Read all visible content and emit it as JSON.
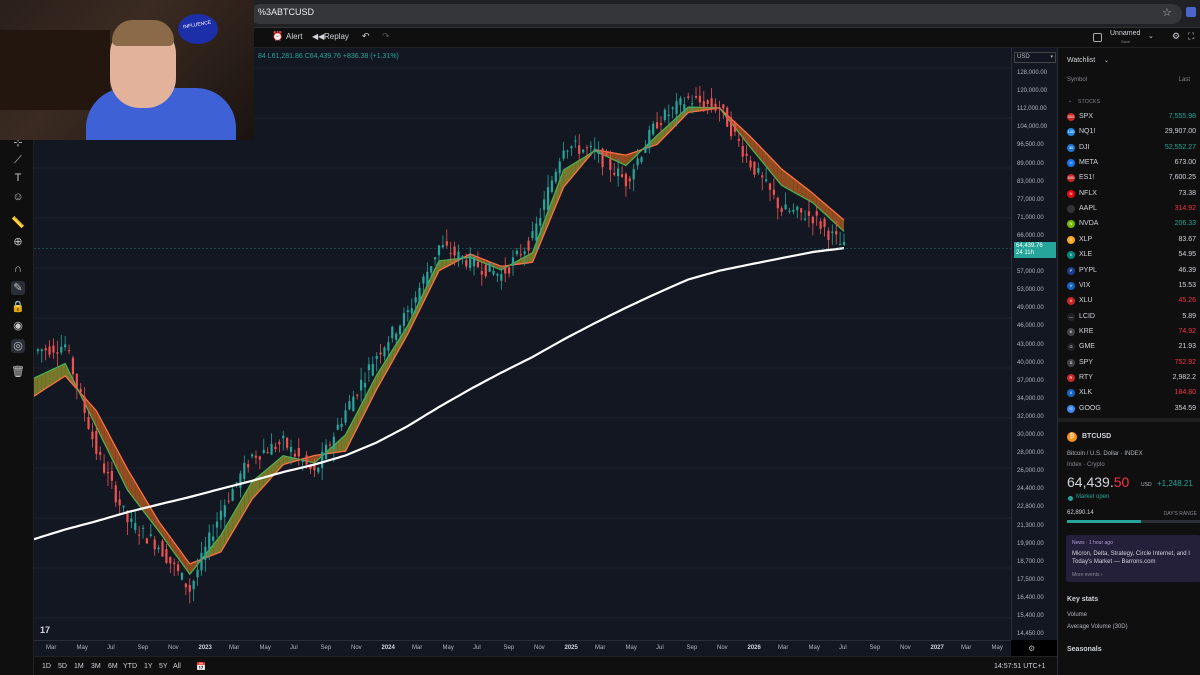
{
  "browser": {
    "url": "%3ABTCUSD"
  },
  "toolbar": {
    "alert_label": "Alert",
    "replay_label": "Replay",
    "layout_name": "Unnamed",
    "layout_sub": "Save"
  },
  "webcam": {
    "logo_text": "INFLUENCE"
  },
  "chart": {
    "ohlc": "84  L61,281.86  C64,439.76  +836.38 (+1.31%)",
    "currency": "USD",
    "last_price": "64,439.76",
    "last_price_sub": "24 11h",
    "price_ticks": [
      "128,000.00",
      "120,000.00",
      "112,000.00",
      "104,000.00",
      "96,500.00",
      "89,000.00",
      "83,000.00",
      "77,000.00",
      "71,000.00",
      "66,000.00",
      "61,000.00",
      "57,000.00",
      "53,000.00",
      "49,000.00",
      "46,000.00",
      "43,000.00",
      "40,000.00",
      "37,000.00",
      "34,000.00",
      "32,000.00",
      "30,000.00",
      "28,000.00",
      "26,000.00",
      "24,400.00",
      "22,800.00",
      "21,300.00",
      "19,900.00",
      "18,700.00",
      "17,500.00",
      "16,400.00",
      "15,400.00",
      "14,450.00"
    ],
    "time_ticks": [
      {
        "label": "Mar",
        "year": false
      },
      {
        "label": "May",
        "year": false
      },
      {
        "label": "Jul",
        "year": false
      },
      {
        "label": "Sep",
        "year": false
      },
      {
        "label": "Nov",
        "year": false
      },
      {
        "label": "2023",
        "year": true
      },
      {
        "label": "Mar",
        "year": false
      },
      {
        "label": "May",
        "year": false
      },
      {
        "label": "Jul",
        "year": false
      },
      {
        "label": "Sep",
        "year": false
      },
      {
        "label": "Nov",
        "year": false
      },
      {
        "label": "2024",
        "year": true
      },
      {
        "label": "Mar",
        "year": false
      },
      {
        "label": "May",
        "year": false
      },
      {
        "label": "Jul",
        "year": false
      },
      {
        "label": "Sep",
        "year": false
      },
      {
        "label": "Nov",
        "year": false
      },
      {
        "label": "2025",
        "year": true
      },
      {
        "label": "Mar",
        "year": false
      },
      {
        "label": "May",
        "year": false
      },
      {
        "label": "Jul",
        "year": false
      },
      {
        "label": "Sep",
        "year": false
      },
      {
        "label": "Nov",
        "year": false
      },
      {
        "label": "2026",
        "year": true
      },
      {
        "label": "Mar",
        "year": false
      },
      {
        "label": "May",
        "year": false
      },
      {
        "label": "Jul",
        "year": false
      },
      {
        "label": "Sep",
        "year": false
      },
      {
        "label": "Nov",
        "year": false
      },
      {
        "label": "2027",
        "year": true
      },
      {
        "label": "Mar",
        "year": false
      },
      {
        "label": "May",
        "year": false
      }
    ],
    "colors": {
      "up": "#26a69a",
      "down": "#ef5350",
      "ribbon_up": "#4caf50",
      "ribbon_down": "#ff7043",
      "ma200": "#ffffff"
    }
  },
  "chart_data": {
    "type": "line",
    "title": "",
    "xlabel": "",
    "ylabel": "",
    "ylog": true,
    "x": [
      "2022-02",
      "2022-04",
      "2022-06",
      "2022-08",
      "2022-10",
      "2022-12",
      "2023-02",
      "2023-04",
      "2023-06",
      "2023-08",
      "2023-10",
      "2023-12",
      "2024-02",
      "2024-04",
      "2024-06",
      "2024-08",
      "2024-10",
      "2024-12",
      "2025-02",
      "2025-04",
      "2025-06",
      "2025-08",
      "2025-10",
      "2025-12",
      "2026-02",
      "2026-04",
      "2026-06"
    ],
    "series": [
      {
        "values": [
          43000,
          44000,
          29000,
          22000,
          20000,
          16800,
          23000,
          28500,
          30000,
          26500,
          34000,
          42500,
          50000,
          65000,
          61000,
          58000,
          67000,
          97000,
          94000,
          84000,
          106000,
          116000,
          112000,
          90000,
          75000,
          73000,
          64440
        ]
      },
      {
        "values": [
          36000,
          39000,
          34000,
          27000,
          22000,
          18600,
          19500,
          24000,
          27500,
          28500,
          29000,
          37000,
          46000,
          59000,
          63000,
          60000,
          61000,
          82000,
          95000,
          93000,
          97000,
          110000,
          112000,
          100000,
          88000,
          80000,
          72000
        ]
      },
      {
        "values": [
          20500,
          21300,
          22000,
          22800,
          23500,
          24200,
          25000,
          25800,
          26700,
          27500,
          28500,
          30000,
          32000,
          34500,
          37000,
          39500,
          42000,
          45000,
          48000,
          51000,
          54000,
          57000,
          59000,
          60500,
          62000,
          63500,
          64500
        ]
      }
    ],
    "last_close": 64439.76
  },
  "watchlist": {
    "title": "Watchlist",
    "col_symbol": "Symbol",
    "col_last": "Last",
    "section": "STOCKS",
    "items": [
      {
        "symbol": "SPX",
        "last": "7,555.98",
        "color": "#26a69a",
        "logo_color": "#c62828",
        "logo": "500"
      },
      {
        "symbol": "NQ1!",
        "last": "29,907.00",
        "color": "#d1d4dc",
        "logo_color": "#1e88e5",
        "logo": "100"
      },
      {
        "symbol": "DJI",
        "last": "52,552.27",
        "color": "#26a69a",
        "logo_color": "#1976d2",
        "logo": "30"
      },
      {
        "symbol": "META",
        "last": "673.00",
        "color": "#d1d4dc",
        "logo_color": "#1877f2",
        "logo": "∞"
      },
      {
        "symbol": "ES1!",
        "last": "7,600.25",
        "color": "#d1d4dc",
        "logo_color": "#c62828",
        "logo": "500"
      },
      {
        "symbol": "NFLX",
        "last": "73.38",
        "color": "#d1d4dc",
        "logo_color": "#e50914",
        "logo": "N"
      },
      {
        "symbol": "AAPL",
        "last": "314.92",
        "color": "#f23645",
        "logo_color": "#333333",
        "logo": ""
      },
      {
        "symbol": "NVDA",
        "last": "206.33",
        "color": "#26a69a",
        "logo_color": "#76b900",
        "logo": "N"
      },
      {
        "symbol": "XLP",
        "last": "83.67",
        "color": "#d1d4dc",
        "logo_color": "#f9a825",
        "logo": "X"
      },
      {
        "symbol": "XLE",
        "last": "54.95",
        "color": "#d1d4dc",
        "logo_color": "#00897b",
        "logo": "X"
      },
      {
        "symbol": "PYPL",
        "last": "46.39",
        "color": "#d1d4dc",
        "logo_color": "#1e3a8a",
        "logo": "P"
      },
      {
        "symbol": "VIX",
        "last": "15.53",
        "color": "#d1d4dc",
        "logo_color": "#1565c0",
        "logo": "V"
      },
      {
        "symbol": "XLU",
        "last": "45.26",
        "color": "#f23645",
        "logo_color": "#c62828",
        "logo": "X"
      },
      {
        "symbol": "LCID",
        "last": "5.89",
        "color": "#d1d4dc",
        "logo_color": "#222222",
        "logo": "—"
      },
      {
        "symbol": "KRE",
        "last": "74.92",
        "color": "#f23645",
        "logo_color": "#444444",
        "logo": "K"
      },
      {
        "symbol": "GME",
        "last": "21.93",
        "color": "#d1d4dc",
        "logo_color": "#222222",
        "logo": "G"
      },
      {
        "symbol": "SPY",
        "last": "752.92",
        "color": "#f23645",
        "logo_color": "#444444",
        "logo": "S"
      },
      {
        "symbol": "RTY",
        "last": "2,982.2",
        "color": "#d1d4dc",
        "logo_color": "#c62828",
        "logo": "R"
      },
      {
        "symbol": "XLK",
        "last": "184.80",
        "color": "#f23645",
        "logo_color": "#1565c0",
        "logo": "X"
      },
      {
        "symbol": "GOOG",
        "last": "354.59",
        "color": "#d1d4dc",
        "logo_color": "#4285f4",
        "logo": "G"
      }
    ]
  },
  "details": {
    "symbol": "BTCUSD",
    "logo": "₿",
    "name": "Bitcoin / U.S. Dollar  ·  INDEX",
    "type": "Index  ·  Crypto",
    "price_int": "64,439.",
    "price_dec": "50",
    "unit": "USD",
    "change": "+1,248.21",
    "status": "Market open",
    "low": "62,890.14",
    "range_label": "DAY'S RANGE",
    "range_fill": 0.55,
    "news_tag": "News  ·  1 hour ago",
    "news_text": "Micron, Delta, Strategy, Circle Internet, and I Today's Market — Barrons.com",
    "news_more": "More events ›",
    "key_stats": "Key stats",
    "volume": "Volume",
    "avg_volume": "Average Volume (30D)",
    "seasonals": "Seasonals"
  },
  "bottom": {
    "ranges": [
      "1D",
      "5D",
      "1M",
      "3M",
      "6M",
      "YTD",
      "1Y",
      "5Y",
      "All"
    ],
    "clock": "14:57:51 UTC+1"
  }
}
